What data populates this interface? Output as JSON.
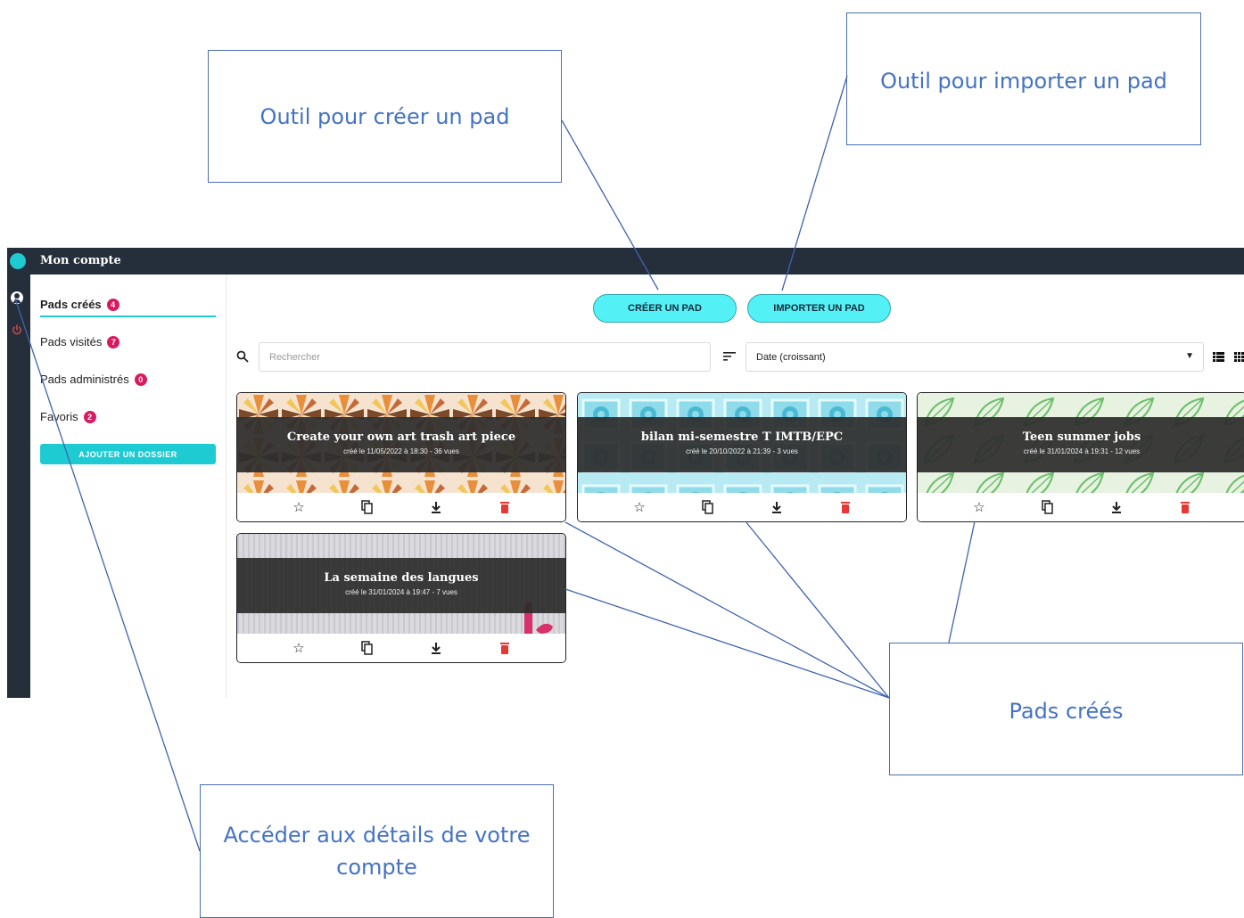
{
  "callouts": {
    "create": "Outil pour créer un pad",
    "import": "Outil pour importer un pad",
    "pads": "Pads créés",
    "account": "Accéder aux détails de votre compte"
  },
  "header": {
    "title": "Mon compte"
  },
  "sidebar": {
    "items": [
      {
        "label": "Pads créés",
        "count": "4"
      },
      {
        "label": "Pads visités",
        "count": "7"
      },
      {
        "label": "Pads administrés",
        "count": "0"
      },
      {
        "label": "Favoris",
        "count": "2"
      }
    ],
    "add_folder_label": "AJOUTER UN DOSSIER"
  },
  "actions": {
    "create_label": "CRÉER UN PAD",
    "import_label": "IMPORTER UN PAD"
  },
  "search": {
    "placeholder": "Rechercher"
  },
  "sort": {
    "selected": "Date (croissant)"
  },
  "pads": [
    {
      "title": "Create your own art trash art piece",
      "meta": "créé le 11/05/2022 à 18:30 - 36 vues"
    },
    {
      "title": "bilan mi-semestre T IMTB/EPC",
      "meta": "créé le 20/10/2022 à 21:39 - 3 vues"
    },
    {
      "title": "Teen summer jobs",
      "meta": "créé le 31/01/2024 à 19:31 - 12 vues"
    },
    {
      "title": "La semaine des langues",
      "meta": "créé le 31/01/2024 à 19:47 - 7 vues"
    }
  ],
  "icons": {
    "logo": "logo-circle",
    "account": "account-circle-icon",
    "power": "power-icon",
    "search": "search-icon",
    "sort": "sort-icon",
    "list_view": "list-view-icon",
    "grid_view": "grid-view-icon",
    "card_actions": [
      "star-icon",
      "copy-icon",
      "download-icon",
      "trash-icon"
    ]
  },
  "colors": {
    "accent": "#1ecbd3",
    "pill": "#53f1f6",
    "badge": "#d81b60",
    "topbar": "#252e3b",
    "delete": "#e53935",
    "callout_text": "#4472c4"
  }
}
